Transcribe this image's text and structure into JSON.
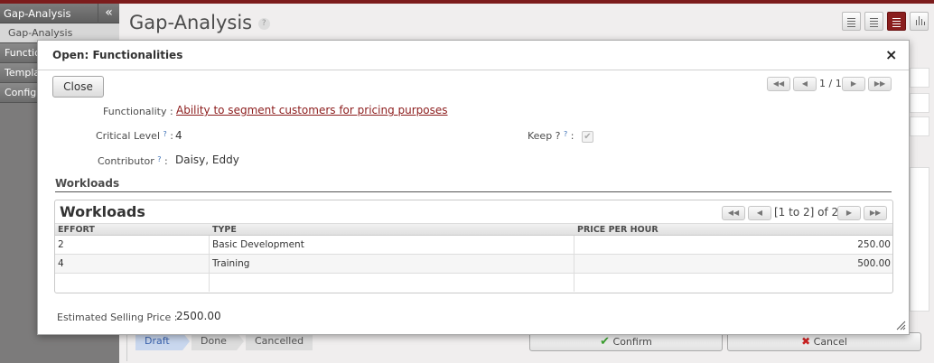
{
  "sidebar": {
    "header": "Gap-Analysis",
    "collapse_glyph": "«",
    "items": [
      {
        "label": "Gap-Analysis"
      },
      {
        "label": "Functionalities"
      },
      {
        "label": "Templates"
      },
      {
        "label": "Configuration"
      }
    ]
  },
  "main": {
    "title": "Gap-Analysis",
    "help": "?",
    "status_steps": [
      "Draft",
      "Done",
      "Cancelled"
    ],
    "confirm_label": "Confirm",
    "cancel_label": "Cancel"
  },
  "dialog": {
    "title": "Open: Functionalities",
    "close_glyph": "×",
    "close_button": "Close",
    "pager": "1 / 1",
    "fields": {
      "functionality_label": "Functionality :",
      "functionality_value": "Ability to segment customers for pricing purposes",
      "critical_label": "Critical Level",
      "critical_value": "4",
      "contributor_label": "Contributor",
      "contributor_value": "Daisy, Eddy",
      "keep_label": "Keep ?",
      "help_mark": "?",
      "colon": ":"
    },
    "workloads_section": "Workloads",
    "workloads": {
      "title": "Workloads",
      "pager": "[1 to 2] of 2",
      "columns": [
        "EFFORT",
        "TYPE",
        "PRICE PER HOUR"
      ],
      "rows": [
        {
          "effort": "2",
          "type": "Basic Development",
          "price": "250.00"
        },
        {
          "effort": "4",
          "type": "Training",
          "price": "500.00"
        }
      ]
    },
    "estimated_label": "Estimated Selling Price :",
    "estimated_value": "2500.00"
  },
  "icons": {
    "pager_first": "◀◀",
    "pager_prev": "◀",
    "pager_next": "▶",
    "pager_last": "▶▶",
    "checkmark": "✔",
    "cancel": "✖"
  },
  "colors": {
    "brand": "#7c1c1c",
    "link": "#8c1c1c",
    "confirm_check": "#3aa12e",
    "cancel_icon": "#cc2222"
  }
}
